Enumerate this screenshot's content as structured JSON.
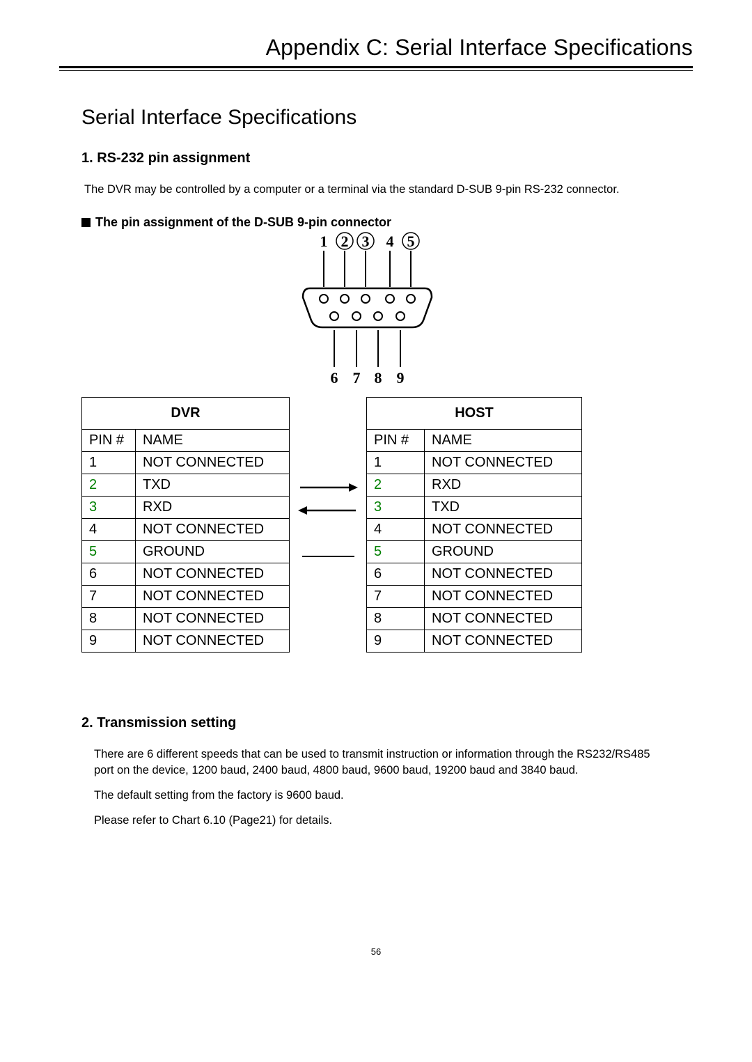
{
  "header": "Appendix C: Serial Interface Specifications",
  "section_title": "Serial Interface Specifications",
  "s1": {
    "heading": "1.  RS-232 pin assignment",
    "body": "The DVR may be controlled by a computer or a terminal via the standard D-SUB 9-pin RS-232 connector.",
    "bullet": "The pin assignment of the D-SUB 9-pin connector"
  },
  "diagram": {
    "top_labels": [
      "1",
      "2",
      "3",
      "4",
      "5"
    ],
    "bottom_labels": [
      "6",
      "7",
      "8",
      "9"
    ],
    "circled": [
      2,
      3,
      5
    ]
  },
  "table_dvr": {
    "title": "DVR",
    "col_pin": "PIN #",
    "col_name": "NAME",
    "rows": [
      {
        "pin": "1",
        "name": "NOT CONNECTED",
        "hl": false
      },
      {
        "pin": "2",
        "name": "TXD",
        "hl": true
      },
      {
        "pin": "3",
        "name": "RXD",
        "hl": true
      },
      {
        "pin": "4",
        "name": "NOT CONNECTED",
        "hl": false
      },
      {
        "pin": "5",
        "name": "GROUND",
        "hl": true
      },
      {
        "pin": "6",
        "name": "NOT CONNECTED",
        "hl": false
      },
      {
        "pin": "7",
        "name": "NOT CONNECTED",
        "hl": false
      },
      {
        "pin": "8",
        "name": "NOT CONNECTED",
        "hl": false
      },
      {
        "pin": "9",
        "name": "NOT CONNECTED",
        "hl": false
      }
    ]
  },
  "table_host": {
    "title": "HOST",
    "col_pin": "PIN #",
    "col_name": "NAME",
    "rows": [
      {
        "pin": "1",
        "name": "NOT CONNECTED",
        "hl": false
      },
      {
        "pin": "2",
        "name": "RXD",
        "hl": true
      },
      {
        "pin": "3",
        "name": "TXD",
        "hl": true
      },
      {
        "pin": "4",
        "name": "NOT CONNECTED",
        "hl": false
      },
      {
        "pin": "5",
        "name": "GROUND",
        "hl": true
      },
      {
        "pin": "6",
        "name": "NOT CONNECTED",
        "hl": false
      },
      {
        "pin": "7",
        "name": "NOT CONNECTED",
        "hl": false
      },
      {
        "pin": "8",
        "name": "NOT CONNECTED",
        "hl": false
      },
      {
        "pin": "9",
        "name": "NOT CONNECTED",
        "hl": false
      }
    ]
  },
  "arrows": [
    "right",
    "left",
    "line"
  ],
  "s2": {
    "heading": "2. Transmission setting",
    "p1": "There are 6 different speeds that can be used to transmit instruction or information through the RS232/RS485 port on the device, 1200 baud, 2400 baud, 4800 baud, 9600 baud, 19200 baud and 3840 baud.",
    "p2": "The default setting from the factory is 9600 baud.",
    "p3": "Please refer to Chart 6.10 (Page21) for details."
  },
  "page_number": "56"
}
